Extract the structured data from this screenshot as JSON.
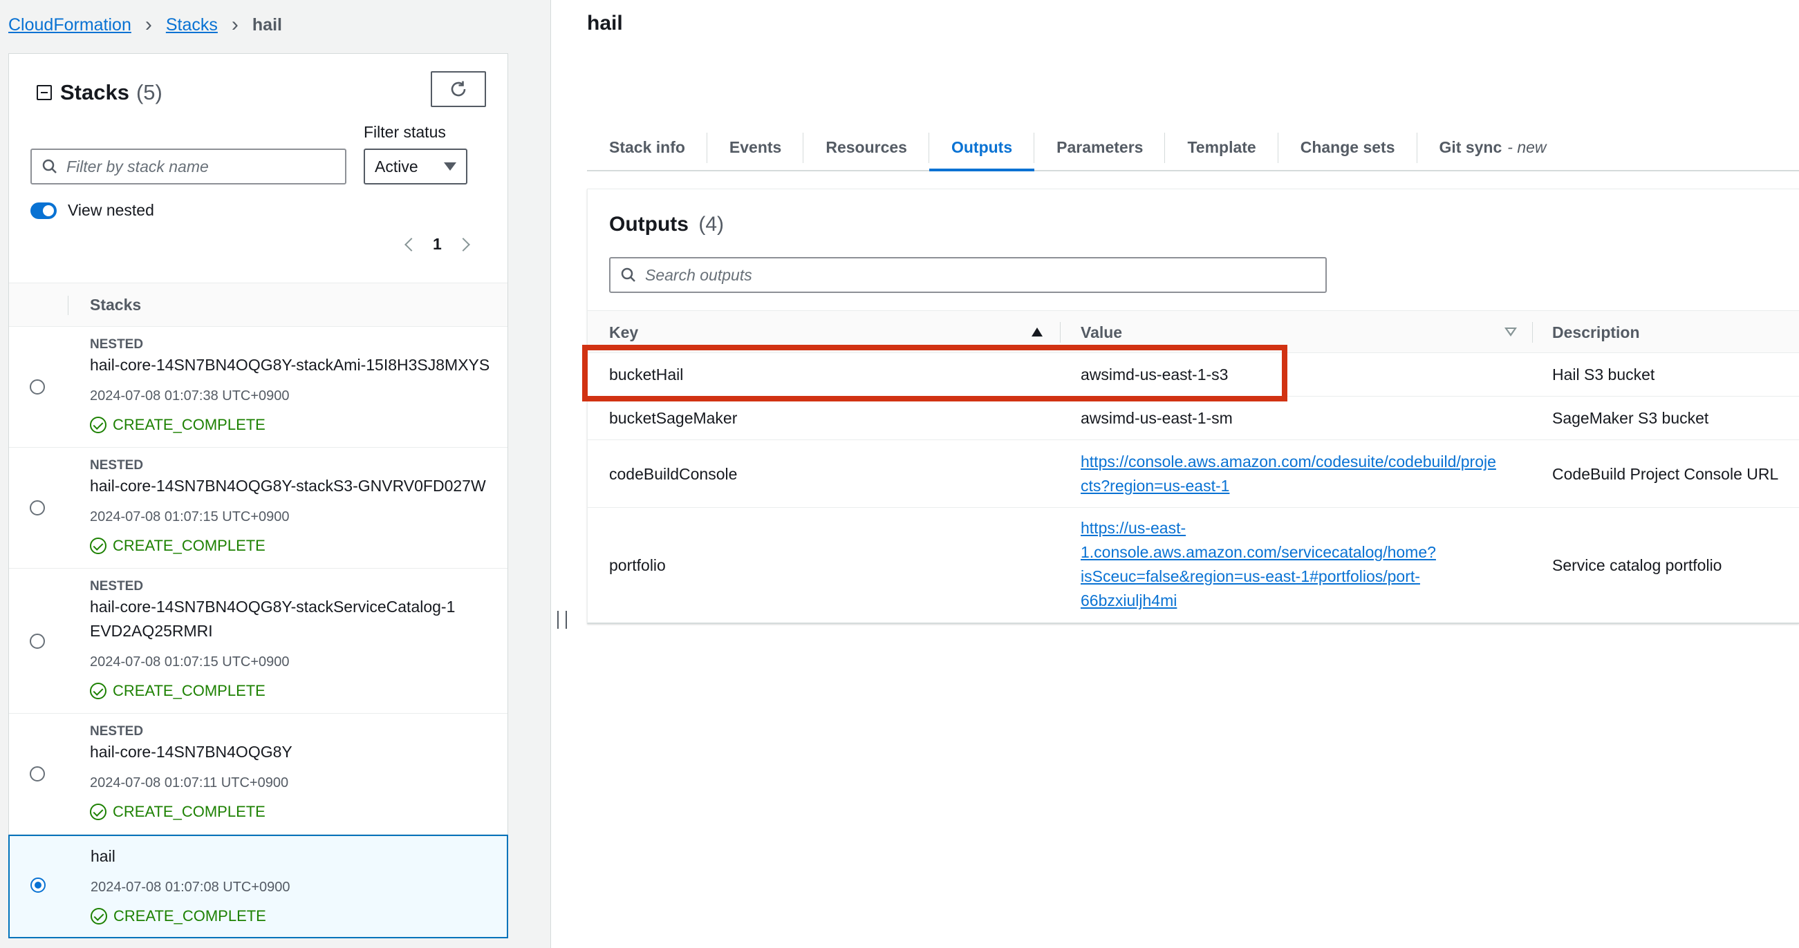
{
  "breadcrumb": {
    "root": "CloudFormation",
    "stacks": "Stacks",
    "current": "hail"
  },
  "stacks_panel": {
    "title": "Stacks",
    "count": "(5)",
    "filter_status_label": "Filter status",
    "search_placeholder": "Filter by stack name",
    "filter_status_value": "Active",
    "view_nested_label": "View nested",
    "page": "1",
    "column_header": "Stacks",
    "rows": [
      {
        "tag": "NESTED",
        "name": "hail-core-14SN7BN4OQG8Y-stackAmi-15I8H3SJ8MXYS",
        "date": "2024-07-08 01:07:38 UTC+0900",
        "status": "CREATE_COMPLETE"
      },
      {
        "tag": "NESTED",
        "name": "hail-core-14SN7BN4OQG8Y-stackS3-GNVRV0FD027W",
        "date": "2024-07-08 01:07:15 UTC+0900",
        "status": "CREATE_COMPLETE"
      },
      {
        "tag": "NESTED",
        "name": "hail-core-14SN7BN4OQG8Y-stackServiceCatalog-1EVD2AQ25RMRI",
        "date": "2024-07-08 01:07:15 UTC+0900",
        "status": "CREATE_COMPLETE"
      },
      {
        "tag": "NESTED",
        "name": "hail-core-14SN7BN4OQG8Y",
        "date": "2024-07-08 01:07:11 UTC+0900",
        "status": "CREATE_COMPLETE"
      },
      {
        "tag": "",
        "name": "hail",
        "date": "2024-07-08 01:07:08 UTC+0900",
        "status": "CREATE_COMPLETE",
        "selected": true
      }
    ]
  },
  "detail": {
    "title": "hail",
    "tabs": [
      {
        "label": "Stack info"
      },
      {
        "label": "Events"
      },
      {
        "label": "Resources"
      },
      {
        "label": "Outputs",
        "active": true
      },
      {
        "label": "Parameters"
      },
      {
        "label": "Template"
      },
      {
        "label": "Change sets"
      },
      {
        "label": "Git sync",
        "suffix": "- new"
      }
    ],
    "outputs": {
      "title": "Outputs",
      "count": "(4)",
      "search_placeholder": "Search outputs",
      "columns": {
        "key": "Key",
        "value": "Value",
        "description": "Description"
      },
      "rows": [
        {
          "key": "bucketHail",
          "value": "awsimd-us-east-1-s3",
          "description": "Hail S3 bucket"
        },
        {
          "key": "bucketSageMaker",
          "value": "awsimd-us-east-1-sm",
          "description": "SageMaker S3 bucket"
        },
        {
          "key": "codeBuildConsole",
          "value_lines": [
            "https://console.aws.amazon.com/codesuite/codebuild/proje",
            "cts?region=us-east-1"
          ],
          "description": "CodeBuild Project Console URL"
        },
        {
          "key": "portfolio",
          "value_lines": [
            "https://us-east-",
            "1.console.aws.amazon.com/servicecatalog/home?",
            "isSceuc=false&region=us-east-1#portfolios/port-",
            "66bzxiuljh4mi"
          ],
          "description": "Service catalog portfolio"
        }
      ]
    }
  },
  "colors": {
    "link": "#0972d3",
    "success": "#1d8102",
    "highlight": "#d13212"
  },
  "icons": [
    "refresh-icon",
    "search-icon",
    "chevron-right-icon",
    "chevron-left-icon",
    "caret-down-icon",
    "check-circle-icon",
    "collapse-icon",
    "sort-ascending-icon",
    "sort-descending-icon",
    "resize-handle-icon"
  ]
}
